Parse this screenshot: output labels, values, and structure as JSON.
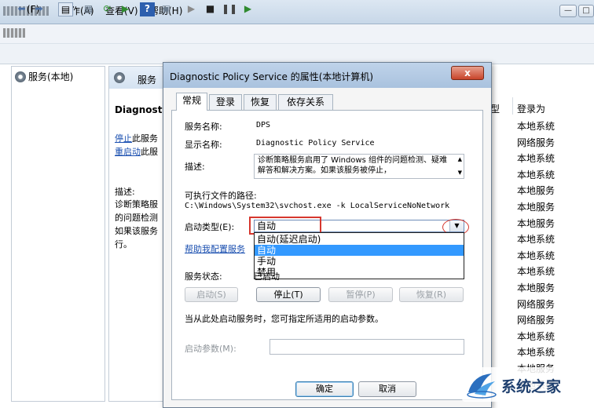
{
  "menubar": {
    "file_label": "(F)",
    "action_label": "操作(A)",
    "view_label": "查看(V)",
    "help_label": "帮助(H)"
  },
  "tree": {
    "root_label": "服务(本地)"
  },
  "center": {
    "header_label": "服务",
    "service_name_truncated": "Diagnosti",
    "stop_link": "停止",
    "stop_suffix": "此服务",
    "restart_link": "重启动",
    "restart_suffix": "此服",
    "desc_heading": "描述:",
    "desc_lines": [
      "诊断策略服",
      "的问题检测",
      "如果该服务",
      "行。"
    ]
  },
  "services_list": {
    "type_header_fragment": "型",
    "logon_header": "登录为",
    "logon_values": [
      "本地系统",
      "网络服务",
      "本地系统",
      "本地系统",
      "本地服务",
      "本地服务",
      "本地服务",
      "本地系统",
      "本地系统",
      "本地系统",
      "本地服务",
      "网络服务",
      "网络服务",
      "本地系统",
      "本地系统",
      "本地服务",
      "本地系统"
    ]
  },
  "dialog": {
    "title": "Diagnostic Policy Service 的属性(本地计算机)",
    "close_glyph": "x",
    "tabs": [
      "常规",
      "登录",
      "恢复",
      "依存关系"
    ],
    "service_name_label": "服务名称:",
    "service_name_value": "DPS",
    "display_name_label": "显示名称:",
    "display_name_value": "Diagnostic Policy Service",
    "description_label": "描述:",
    "description_text": "诊断策略服务启用了 Windows 组件的问题检测、疑难解答和解决方案。如果该服务被停止，",
    "exe_path_label": "可执行文件的路径:",
    "exe_path_value": "C:\\Windows\\System32\\svchost.exe -k LocalServiceNoNetwork",
    "startup_type_label": "启动类型(E):",
    "startup_type_value": "自动",
    "startup_options": [
      "自动(延迟启动)",
      "自动",
      "手动",
      "禁用"
    ],
    "startup_selected_index": 1,
    "help_link": "帮助我配置服务",
    "status_label": "服务状态:",
    "status_value": "已启动",
    "btn_start": "启动(S)",
    "btn_stop": "停止(T)",
    "btn_pause": "暂停(P)",
    "btn_resume": "恢复(R)",
    "hint_text": "当从此处启动服务时，您可指定所适用的启动参数。",
    "params_label": "启动参数(M):",
    "ok_label": "确定",
    "cancel_label": "取消"
  },
  "watermark": {
    "text": "系统之家"
  },
  "colors": {
    "highlight_red": "#d6372e",
    "selection_blue": "#3399ff",
    "link_blue": "#1a4fb0"
  }
}
